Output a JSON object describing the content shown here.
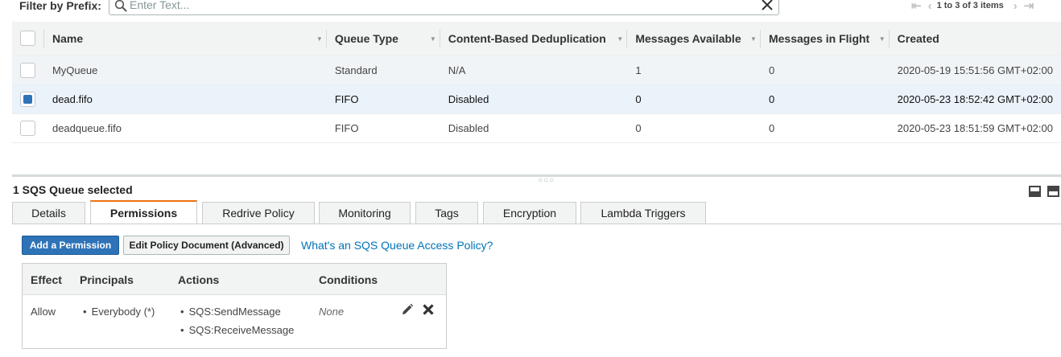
{
  "filter": {
    "label": "Filter by Prefix:",
    "placeholder": "Enter Text..."
  },
  "pager": {
    "text": "1 to 3 of 3 items"
  },
  "table": {
    "headers": {
      "name": "Name",
      "queue_type": "Queue Type",
      "dedup": "Content-Based Deduplication",
      "available": "Messages Available",
      "in_flight": "Messages in Flight",
      "created": "Created"
    },
    "rows": [
      {
        "name": "MyQueue",
        "queue_type": "Standard",
        "dedup": "N/A",
        "available": "1",
        "in_flight": "0",
        "created": "2020-05-19 15:51:56 GMT+02:00",
        "selected": false
      },
      {
        "name": "dead.fifo",
        "queue_type": "FIFO",
        "dedup": "Disabled",
        "available": "0",
        "in_flight": "0",
        "created": "2020-05-23 18:52:42 GMT+02:00",
        "selected": true
      },
      {
        "name": "deadqueue.fifo",
        "queue_type": "FIFO",
        "dedup": "Disabled",
        "available": "0",
        "in_flight": "0",
        "created": "2020-05-23 18:51:59 GMT+02:00",
        "selected": false
      }
    ]
  },
  "details": {
    "selected_title": "1 SQS Queue selected",
    "tabs": [
      "Details",
      "Permissions",
      "Redrive Policy",
      "Monitoring",
      "Tags",
      "Encryption",
      "Lambda Triggers"
    ],
    "active_tab": "Permissions",
    "add_permission_label": "Add a Permission",
    "edit_policy_label": "Edit Policy Document (Advanced)",
    "help_link": "What's an SQS Queue Access Policy?",
    "permissions": {
      "headers": {
        "effect": "Effect",
        "principals": "Principals",
        "actions": "Actions",
        "conditions": "Conditions"
      },
      "rows": [
        {
          "effect": "Allow",
          "principal": "Everybody (*)",
          "actions": [
            "SQS:SendMessage",
            "SQS:ReceiveMessage"
          ],
          "conditions": "None"
        }
      ]
    }
  },
  "colors": {
    "primary_button": "#2e73b8",
    "active_tab_accent": "#ec7211",
    "link": "#0073bb",
    "selected_row": "#eaf2fa"
  }
}
